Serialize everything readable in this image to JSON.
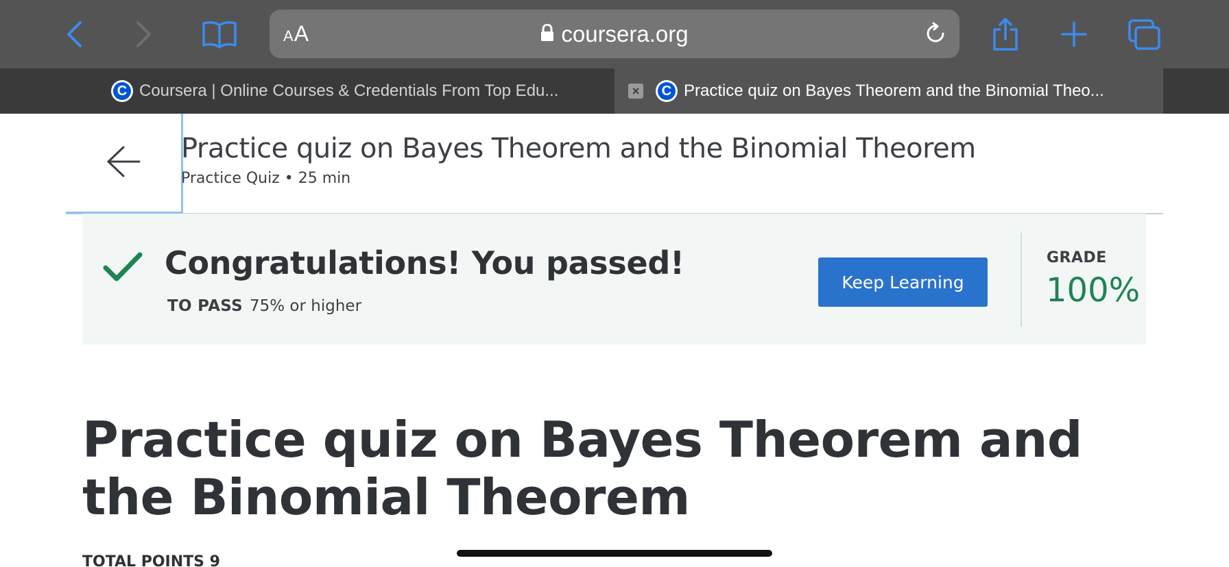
{
  "browser": {
    "aa_small": "A",
    "aa_big": "A",
    "url": "coursera.org",
    "icons": {
      "back": "chevron-left-icon",
      "forward": "chevron-right-icon",
      "bookmarks": "book-icon",
      "lock": "lock-icon",
      "reload": "reload-icon",
      "share": "share-icon",
      "new_tab": "plus-icon",
      "tabs": "tabs-icon"
    },
    "accent_color": "#3b8cf0"
  },
  "tabs": [
    {
      "title": "Coursera | Online Courses & Credentials From Top Edu...",
      "favicon": "C",
      "active": false
    },
    {
      "title": "Practice quiz on Bayes Theorem and the Binomial Theo...",
      "favicon": "C",
      "active": true,
      "close": "×"
    }
  ],
  "quiz_header": {
    "title": "Practice quiz on Bayes Theorem and the Binomial Theorem",
    "meta": "Practice Quiz • 25 min"
  },
  "result": {
    "message": "Congratulations! You passed!",
    "to_pass_label": "TO PASS",
    "to_pass_value": "75% or higher",
    "keep_learning": "Keep Learning",
    "grade_label": "GRADE",
    "grade_value": "100%",
    "pass_color": "#1f8354"
  },
  "content": {
    "title": "Practice quiz on Bayes Theorem and the Binomial Theorem",
    "total_points": "TOTAL POINTS 9"
  }
}
